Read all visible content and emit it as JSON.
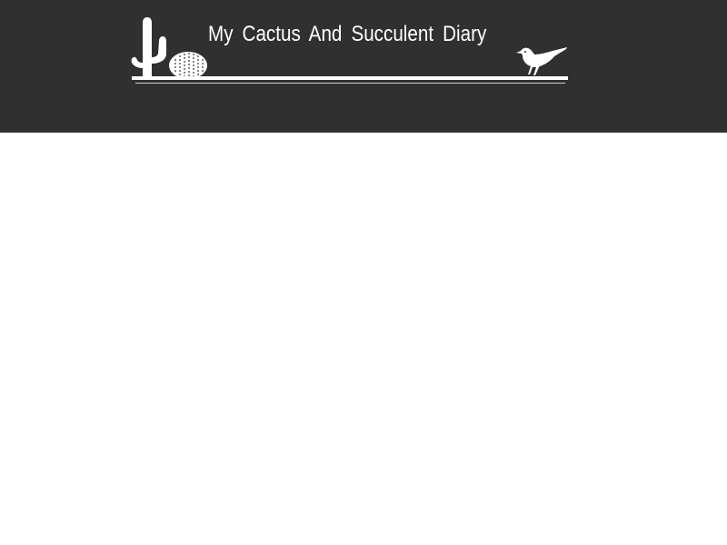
{
  "header": {
    "site_title": "My Cactus And Succulent Diary",
    "background_color": "#303030",
    "text_color": "#ffffff"
  },
  "banner": {
    "icons": [
      "cactus-icon",
      "barrel-cactus-icon",
      "bird-icon"
    ],
    "shelf_color": "#ffffff"
  },
  "main": {
    "background_color": "#ffffff"
  }
}
